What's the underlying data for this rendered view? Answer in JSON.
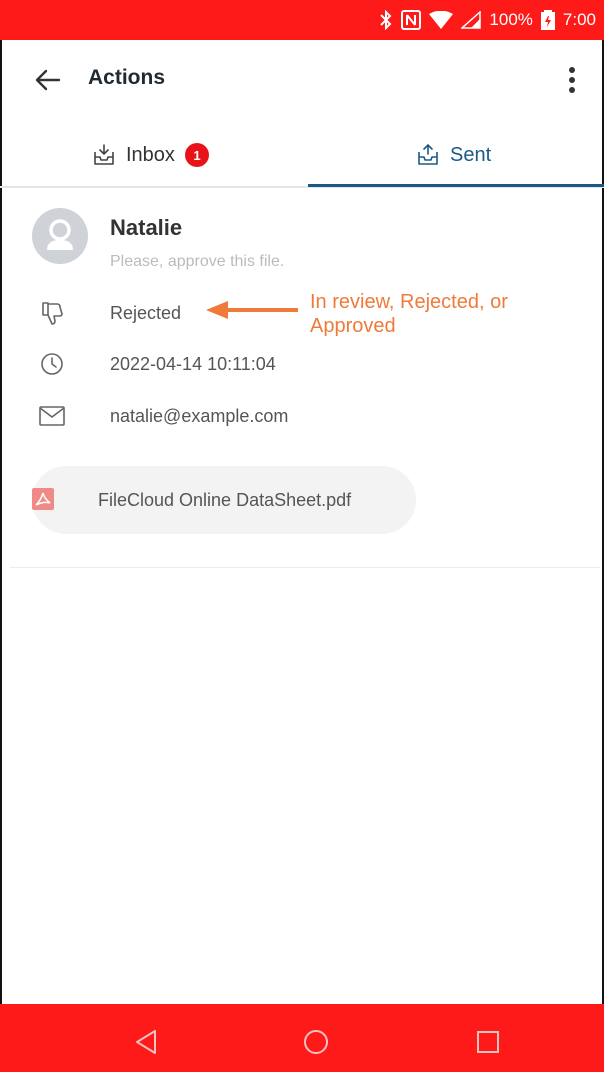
{
  "status_bar": {
    "battery": "100%",
    "time": "7:00",
    "icons": [
      "bluetooth-icon",
      "nfc-icon",
      "wifi-icon",
      "signal-icon",
      "battery-charging-icon"
    ]
  },
  "app_bar": {
    "title": "Actions",
    "back_icon": "arrow-left-icon",
    "more_icon": "more-vertical-icon"
  },
  "tabs": [
    {
      "label": "Inbox",
      "badge": "1",
      "icon": "inbox-download-icon",
      "active": false
    },
    {
      "label": "Sent",
      "icon": "inbox-upload-icon",
      "active": true
    }
  ],
  "action_item": {
    "sender": "Natalie",
    "message": "Please, approve this file.",
    "status": "Rejected",
    "datetime": "2022-04-14 10:11:04",
    "email": "natalie@example.com",
    "file_name": "FileCloud Online DataSheet.pdf"
  },
  "annotation": {
    "text": "In review, Rejected, or Approved"
  },
  "colors": {
    "status_bar": "#ff1a1a",
    "accent": "#1b5a86",
    "badge": "#e8131a",
    "annotation": "#f07a3a"
  }
}
